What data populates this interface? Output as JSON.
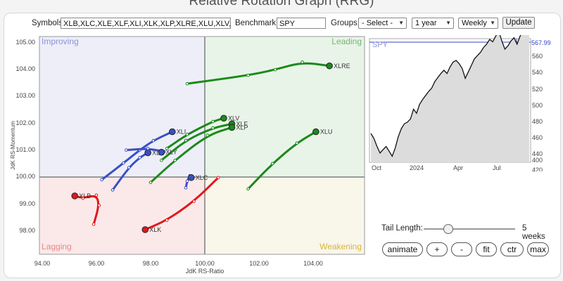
{
  "header": {
    "title": "Relative Rotation Graph (RRG)"
  },
  "controls": {
    "symbols_label": "Symbols:",
    "symbols_value": "XLB,XLC,XLE,XLF,XLI,XLK,XLP,XLRE,XLU,XLV,XL",
    "benchmark_label": "Benchmark:",
    "benchmark_value": "SPY",
    "groups_label": "Groups:",
    "groups_selected": "- Select -",
    "period_selected": "1 year",
    "frequency_selected": "Weekly",
    "update_label": "Update"
  },
  "rrg": {
    "quadrants": {
      "improving": "Improving",
      "leading": "Leading",
      "lagging": "Lagging",
      "weakening": "Weakening"
    },
    "colors": {
      "improving": "#eeeef8",
      "leading": "#e9f4e9",
      "lagging": "#fbe9e9",
      "weakening": "#f9f6ea"
    },
    "x_axis_label": "JdK RS-Ratio",
    "y_axis_label": "JdK RS-Momentum",
    "x_ticks": [
      "94.00",
      "96.00",
      "98.00",
      "100.00",
      "102.00",
      "104.00"
    ],
    "y_ticks": [
      "105.00",
      "104.00",
      "103.00",
      "102.00",
      "101.00",
      "100.00",
      "99.00",
      "98.00"
    ],
    "tails": [
      {
        "symbol": "XLRE",
        "color": "#1a8a1a",
        "points": [
          [
            99.35,
            103.46
          ],
          [
            101.6,
            103.77
          ],
          [
            102.6,
            103.98
          ],
          [
            103.6,
            104.26
          ],
          [
            104.6,
            104.12
          ]
        ]
      },
      {
        "symbol": "XLV",
        "color": "#1a8a1a",
        "points": [
          [
            98.6,
            101.06
          ],
          [
            99.35,
            101.58
          ],
          [
            100.3,
            102.06
          ],
          [
            100.7,
            102.18
          ]
        ]
      },
      {
        "symbol": "XLF",
        "color": "#1a8a1a",
        "points": [
          [
            98.4,
            100.62
          ],
          [
            99.3,
            101.36
          ],
          [
            100.3,
            101.82
          ],
          [
            101.0,
            101.97
          ]
        ]
      },
      {
        "symbol": "XLP",
        "color": "#1a8a1a",
        "points": [
          [
            98.0,
            99.8
          ],
          [
            98.9,
            100.62
          ],
          [
            100.1,
            101.55
          ],
          [
            101.0,
            101.84
          ]
        ]
      },
      {
        "symbol": "XLU",
        "color": "#1a8a1a",
        "points": [
          [
            101.6,
            99.56
          ],
          [
            102.5,
            100.5
          ],
          [
            103.4,
            101.26
          ],
          [
            104.1,
            101.68
          ]
        ]
      },
      {
        "symbol": "XLI",
        "color": "#3a4fc4",
        "points": [
          [
            96.2,
            99.9
          ],
          [
            97.0,
            100.52
          ],
          [
            97.6,
            101.0
          ],
          [
            98.1,
            101.35
          ],
          [
            98.8,
            101.68
          ]
        ]
      },
      {
        "symbol": "XLE",
        "color": "#3a4fc4",
        "points": [
          [
            96.6,
            99.52
          ],
          [
            97.2,
            100.35
          ],
          [
            97.6,
            100.72
          ],
          [
            97.9,
            100.9
          ]
        ]
      },
      {
        "symbol": "XLY",
        "color": "#3a4fc4",
        "points": [
          [
            97.1,
            101.0
          ],
          [
            97.9,
            101.06
          ],
          [
            98.5,
            100.94
          ],
          [
            98.4,
            100.92
          ]
        ]
      },
      {
        "symbol": "XLC",
        "color": "#3a4fc4",
        "points": [
          [
            99.3,
            99.6
          ],
          [
            99.35,
            99.85
          ],
          [
            99.45,
            100.05
          ],
          [
            99.5,
            99.98
          ]
        ]
      },
      {
        "symbol": "XLB",
        "color": "#e0181c",
        "points": [
          [
            95.9,
            98.25
          ],
          [
            96.1,
            98.95
          ],
          [
            96.0,
            99.33
          ],
          [
            95.5,
            99.22
          ],
          [
            95.2,
            99.3
          ]
        ]
      },
      {
        "symbol": "XLK",
        "color": "#e0181c",
        "points": [
          [
            100.5,
            99.98
          ],
          [
            99.6,
            99.1
          ],
          [
            98.6,
            98.4
          ],
          [
            97.8,
            98.05
          ]
        ]
      }
    ]
  },
  "spy_chart": {
    "title": "SPY",
    "y_ticks": [
      "560",
      "540",
      "520",
      "500",
      "480",
      "460",
      "440",
      "420",
      "400"
    ],
    "x_ticks": [
      "Oct",
      "2024",
      "Apr",
      "Jul"
    ],
    "last_value": "567.99",
    "values": [
      432,
      426,
      416,
      408,
      412,
      416,
      410,
      404,
      414,
      428,
      438,
      444,
      446,
      450,
      462,
      457,
      468,
      474,
      479,
      484,
      488,
      496,
      501,
      506,
      510,
      506,
      514,
      520,
      522,
      518,
      512,
      500,
      508,
      516,
      524,
      528,
      532,
      538,
      542,
      548,
      545,
      552,
      558,
      546,
      536,
      540,
      546,
      550,
      542,
      552,
      558,
      565,
      568
    ]
  },
  "tail": {
    "label": "Tail Length:",
    "value_text": "5 weeks",
    "fraction": 0.27
  },
  "buttons": {
    "animate": "animate",
    "plus": "+",
    "minus": "-",
    "fit": "fit",
    "ctr": "ctr",
    "max": "max"
  }
}
